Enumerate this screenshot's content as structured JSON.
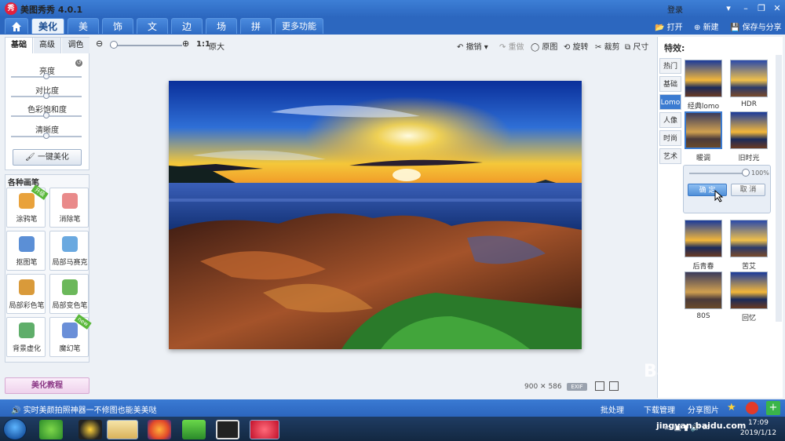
{
  "window": {
    "title": "美图秀秀 4.0.1",
    "logo_text": "秀",
    "login": "登录",
    "min": "–",
    "restore": "❐",
    "close": "✕"
  },
  "tabs": [
    "美化",
    "美容",
    "饰品",
    "文字",
    "边框",
    "场景",
    "拼图",
    "更多功能 ▾"
  ],
  "top_actions": {
    "open": "打开",
    "new": "新建",
    "save": "保存与分享"
  },
  "left": {
    "subtabs": [
      "基础",
      "高级",
      "调色"
    ],
    "adjustments": [
      {
        "label": "亮度",
        "value": 0.5
      },
      {
        "label": "对比度",
        "value": 0.5
      },
      {
        "label": "色彩饱和度",
        "value": 0.5
      },
      {
        "label": "清晰度",
        "value": 0.5
      }
    ],
    "onekey": "一键美化",
    "brushes_title": "各种画笔",
    "brushes": [
      {
        "label": "涂鸦笔",
        "badge": "升级",
        "color": "#e9a23b"
      },
      {
        "label": "消除笔",
        "badge": "",
        "color": "#e98a8a"
      },
      {
        "label": "抠图笔",
        "badge": "",
        "color": "#5b8fd6"
      },
      {
        "label": "局部马赛克",
        "badge": "",
        "color": "#6aa9e0"
      },
      {
        "label": "局部彩色笔",
        "badge": "",
        "color": "#d99a3a"
      },
      {
        "label": "局部变色笔",
        "badge": "",
        "color": "#6bb85a"
      },
      {
        "label": "背景虚化",
        "badge": "",
        "color": "#5fae6a"
      },
      {
        "label": "魔幻笔",
        "badge": "new",
        "color": "#6a8fd8"
      }
    ],
    "tutorial": "美化教程"
  },
  "toolbar": {
    "zoom_ratio": "1:1",
    "zoom_label": "原大",
    "undo": "撤销",
    "redo": "重做",
    "original": "原图",
    "rotate": "旋转",
    "crop": "裁剪",
    "size": "尺寸"
  },
  "image_info": {
    "size_text": "900 ✕ 586",
    "exif": "EXIF"
  },
  "right": {
    "title": "特效:",
    "categories": [
      "热门",
      "基础",
      "Lomo",
      "人像",
      "时尚",
      "艺术"
    ],
    "active_category": "Lomo",
    "effects_top": [
      {
        "label": "经典lomo"
      },
      {
        "label": "HDR"
      },
      {
        "label": "暖调"
      },
      {
        "label": "旧时光"
      }
    ],
    "intensity": {
      "value": 1.0,
      "label": "100%"
    },
    "ok": "确 定",
    "cancel": "取 消",
    "effects_bottom": [
      {
        "label": "后青春"
      },
      {
        "label": "苦艾"
      },
      {
        "label": "80S"
      },
      {
        "label": "回忆"
      }
    ]
  },
  "status": {
    "tip": "实时美颜拍照神器一不修图也能美美哒",
    "batch": "批处理",
    "download": "下载管理",
    "share": "分享图片"
  },
  "taskbar": {
    "time": "17:09",
    "date": "2019/1/12"
  },
  "watermark": {
    "text": "Bai 经验",
    "url": "jingyan.baidu.com"
  }
}
